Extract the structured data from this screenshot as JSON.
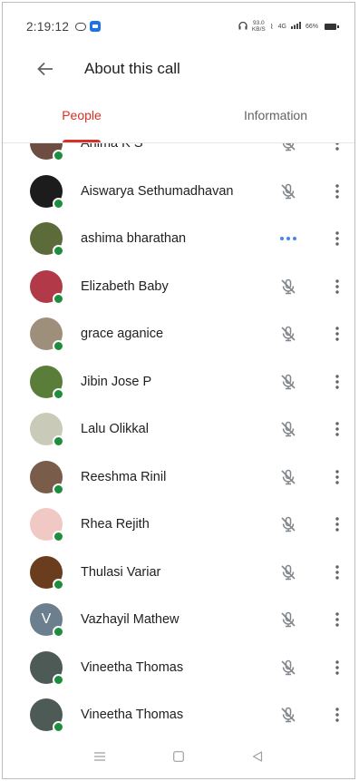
{
  "status_bar": {
    "time": "2:19:12",
    "net_top": "93.0",
    "net_bottom": "KB/S",
    "signal": "4G",
    "battery": "66%"
  },
  "header": {
    "back_icon": "arrow-back-icon",
    "title": "About this call"
  },
  "tabs": [
    {
      "label": "People",
      "selected": true
    },
    {
      "label": "Information",
      "selected": false
    }
  ],
  "colors": {
    "accent": "#d93025",
    "online": "#1e8e3e",
    "speaking": "#4285f4"
  },
  "participants": [
    {
      "name": "Anima K S",
      "status": "muted",
      "avatar": "#6d4c41"
    },
    {
      "name": "Aiswarya Sethumadhavan",
      "status": "muted",
      "avatar": "#1c1c1c"
    },
    {
      "name": "ashima bharathan",
      "status": "speaking",
      "avatar": "#5b6b3a"
    },
    {
      "name": "Elizabeth Baby",
      "status": "muted",
      "avatar": "#b23a48"
    },
    {
      "name": "grace aganice",
      "status": "muted",
      "avatar": "#9e8f7a"
    },
    {
      "name": "Jibin Jose P",
      "status": "muted",
      "avatar": "#5a7d3a"
    },
    {
      "name": "Lalu Olikkal",
      "status": "muted",
      "avatar": "#c9cbb8"
    },
    {
      "name": "Reeshma Rinil",
      "status": "muted",
      "avatar": "#7a5c4a"
    },
    {
      "name": "Rhea Rejith",
      "status": "muted",
      "avatar": "#f0c9c4"
    },
    {
      "name": "Thulasi Variar",
      "status": "muted",
      "avatar": "#6a3d1e"
    },
    {
      "name": "Vazhayil Mathew",
      "status": "muted",
      "avatar": "#6b7f8e",
      "initial": "V"
    },
    {
      "name": "Vineetha Thomas",
      "status": "muted",
      "avatar": "#4e5a55"
    },
    {
      "name": "Vineetha Thomas",
      "status": "muted",
      "avatar": "#4e5a55"
    }
  ],
  "icons": {
    "muted": "mic-off-icon",
    "speaking": "speaking-indicator-icon",
    "more": "more-vert-icon"
  },
  "nav_bar": [
    "recents-icon",
    "home-icon",
    "back-icon"
  ]
}
